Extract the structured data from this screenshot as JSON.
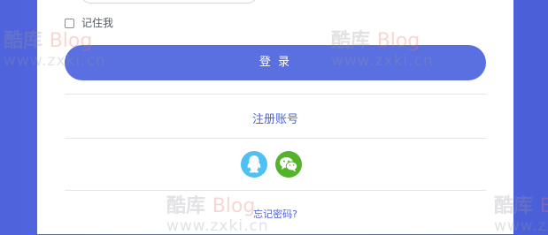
{
  "form": {
    "remember_label": "记住我",
    "login_button": "登 录",
    "register_link": "注册账号",
    "forgot_link": "忘记密码?"
  },
  "social": {
    "qq_icon": "qq-penguin-icon",
    "wechat_icon": "wechat-icon"
  },
  "watermark": {
    "line1": "酷库",
    "line1_brand": "Blog",
    "line2": "www.zxki.cn"
  },
  "colors": {
    "background": "#4f63dd",
    "primary": "#5a6fe0",
    "link": "#4d63d9",
    "qq": "#4ec0f3",
    "wechat": "#53b42c"
  }
}
